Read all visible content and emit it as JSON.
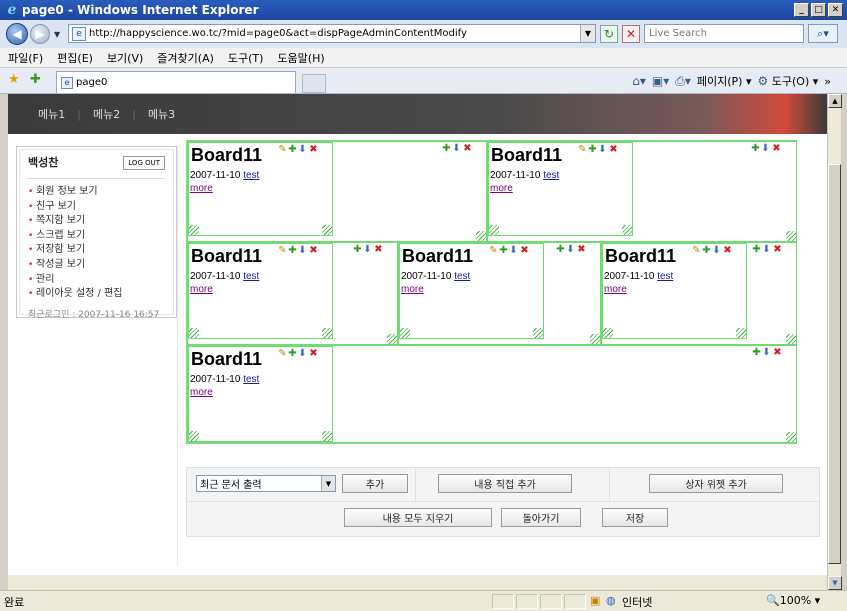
{
  "window": {
    "title": "page0 - Windows Internet Explorer"
  },
  "address": {
    "url": "http://happyscience.wo.tc/?mid=page0&act=dispPageAdminContentModify",
    "search_placeholder": "Live Search"
  },
  "menu": [
    "파일(F)",
    "편집(E)",
    "보기(V)",
    "즐겨찾기(A)",
    "도구(T)",
    "도움말(H)"
  ],
  "tab": {
    "label": "page0"
  },
  "commandbar": {
    "page": "페이지(P)",
    "tools": "도구(O)"
  },
  "site_nav": [
    "메뉴1",
    "메뉴2",
    "메뉴3"
  ],
  "login": {
    "user": "백성찬",
    "logout": "LOG OUT",
    "links": [
      "회원 정보 보기",
      "친구 보기",
      "쪽지함 보기",
      "스크랩 보기",
      "저장함 보기",
      "작성글 보기",
      "관리",
      "레이아웃 설정 / 편집"
    ],
    "last_login": "최근로그인 : 2007-11-16 16:57"
  },
  "widgets": [
    {
      "title": "Board11",
      "date": "2007-11-10",
      "author": "test",
      "more": "more"
    },
    {
      "title": "Board11",
      "date": "2007-11-10",
      "author": "test",
      "more": "more"
    },
    {
      "title": "Board11",
      "date": "2007-11-10",
      "author": "test",
      "more": "more"
    },
    {
      "title": "Board11",
      "date": "2007-11-10",
      "author": "test",
      "more": "more"
    },
    {
      "title": "Board11",
      "date": "2007-11-10",
      "author": "test",
      "more": "more"
    },
    {
      "title": "Board11",
      "date": "2007-11-10",
      "author": "test",
      "more": "more"
    }
  ],
  "editor": {
    "select_value": "최근 문서 출력",
    "add": "추가",
    "add_content": "내용 직접 추가",
    "add_box_widget": "상자 위젯 추가",
    "clear_all": "내용 모두 지우기",
    "back": "돌아가기",
    "save": "저장"
  },
  "status": {
    "text": "완료",
    "zone": "인터넷",
    "zoom": "100%"
  }
}
